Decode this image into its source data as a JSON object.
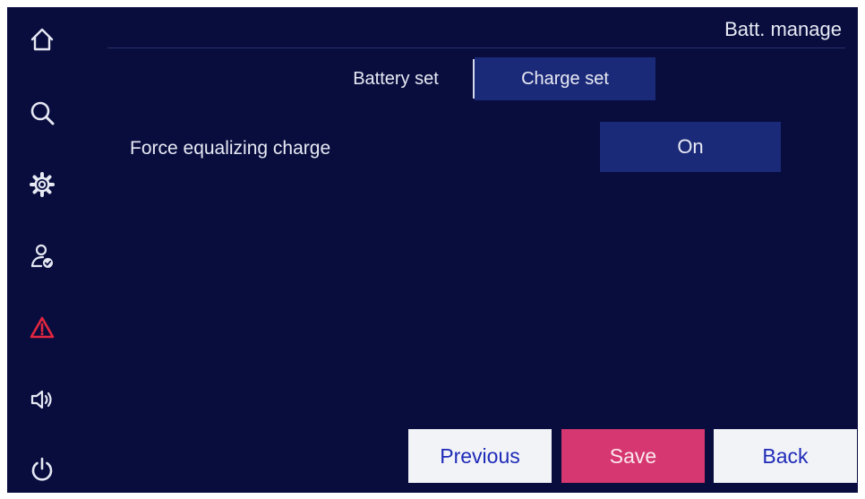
{
  "header": {
    "title": "Batt. manage"
  },
  "tabs": [
    {
      "label": "Battery set",
      "active": false
    },
    {
      "label": "Charge set",
      "active": true
    }
  ],
  "settings": [
    {
      "label": "Force equalizing charge",
      "value": "On"
    }
  ],
  "sidebar": {
    "icons": [
      "home-icon",
      "search-icon",
      "settings-icon",
      "user-check-icon",
      "alarm-warning-icon",
      "speaker-icon",
      "power-icon"
    ]
  },
  "footer": {
    "previous_label": "Previous",
    "save_label": "Save",
    "back_label": "Back"
  },
  "colors": {
    "background": "#080d3e",
    "tab_active": "#1b2a78",
    "alarm": "#e3263f",
    "save": "#d63770",
    "button_text": "#1e2ab8"
  }
}
